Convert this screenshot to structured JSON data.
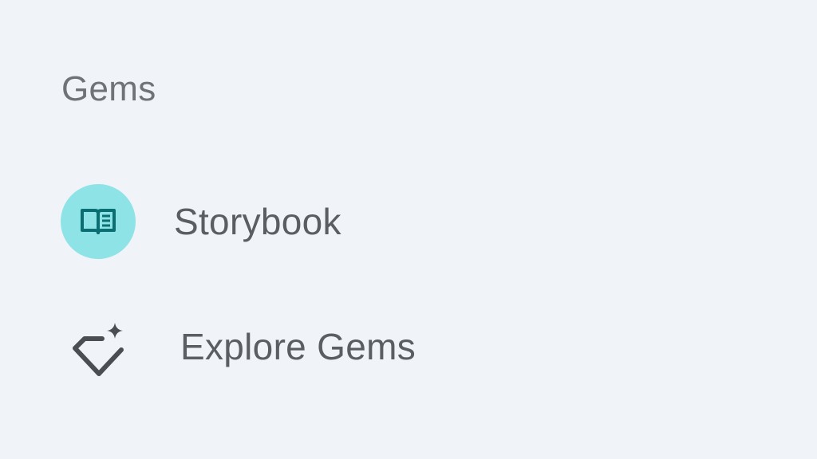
{
  "section": {
    "heading": "Gems"
  },
  "items": [
    {
      "label": "Storybook",
      "icon": "open-book-icon",
      "icon_bg": "#8ee3e6",
      "icon_color": "#0b6e73"
    },
    {
      "label": "Explore Gems",
      "icon": "gem-sparkle-icon",
      "icon_color": "#4a4d52"
    }
  ],
  "colors": {
    "background": "#f0f4f9",
    "heading_text": "#6f7277",
    "item_text": "#5a5d62"
  }
}
